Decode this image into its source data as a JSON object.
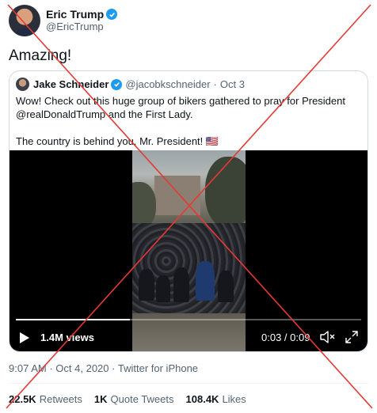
{
  "tweet": {
    "author": {
      "name": "Eric Trump",
      "handle": "@EricTrump",
      "verified_icon": "verified-badge-icon"
    },
    "text": "Amazing!",
    "meta": {
      "time": "9:07 AM",
      "separator": "·",
      "date": "Oct 4, 2020",
      "source": "Twitter for iPhone"
    },
    "stats": {
      "retweets": {
        "count": "22.5K",
        "label": "Retweets"
      },
      "quote_tweets": {
        "count": "1K",
        "label": "Quote Tweets"
      },
      "likes": {
        "count": "108.4K",
        "label": "Likes"
      }
    }
  },
  "quote": {
    "author": {
      "name": "Jake Schneider",
      "handle": "@jacobkschneider",
      "separator": "·",
      "date": "Oct 3"
    },
    "text_line1": "Wow! Check out this huge group of bikers gathered to pray for President @realDonaldTrump and the First Lady.",
    "text_line2": "The country is behind you, Mr. President! 🇺🇸",
    "video": {
      "views": "1.4M views",
      "time": "0:03 / 0:09",
      "progress": 0.33,
      "icons": {
        "play": "play-icon",
        "mute": "muted-speaker-icon",
        "fullscreen": "fullscreen-icon"
      }
    }
  },
  "colors": {
    "overlay_cross": "#e53935",
    "link": "#1d9bf0",
    "secondary_text": "#536471",
    "primary_text": "#0f1419"
  }
}
